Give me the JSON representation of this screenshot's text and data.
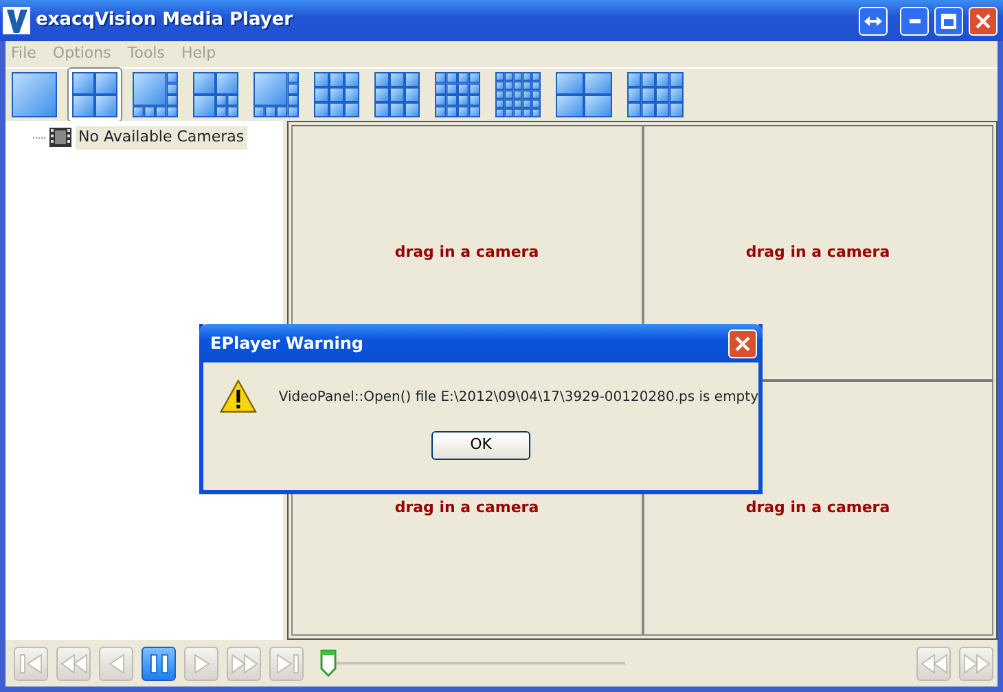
{
  "window": {
    "title": "exacqVision Media Player"
  },
  "menu": [
    "File",
    "Options",
    "Tools",
    "Help"
  ],
  "layouts": [
    {
      "selected": false
    },
    {
      "selected": true
    },
    {
      "selected": false
    },
    {
      "selected": false
    },
    {
      "selected": false
    },
    {
      "selected": false
    },
    {
      "selected": false
    },
    {
      "selected": false
    },
    {
      "selected": false
    },
    {
      "selected": false
    },
    {
      "selected": false
    }
  ],
  "tree": [
    {
      "label": "No Available Cameras",
      "selected": true
    }
  ],
  "video_cells": [
    "drag in a camera",
    "drag in a camera",
    "drag in a camera",
    "drag in a camera"
  ],
  "transport": [
    {
      "kind": "first",
      "selected": false
    },
    {
      "kind": "rewind",
      "selected": false
    },
    {
      "kind": "back",
      "selected": false
    },
    {
      "kind": "pause",
      "selected": true
    },
    {
      "kind": "play",
      "selected": false
    },
    {
      "kind": "forward",
      "selected": false
    },
    {
      "kind": "last",
      "selected": false
    }
  ],
  "timeline": {
    "level": 0
  },
  "transport_end": [
    {
      "kind": "rewind",
      "selected": false
    },
    {
      "kind": "forward",
      "selected": false
    }
  ],
  "dialog": {
    "title": "EPlayer Warning",
    "message": "VideoPanel::Open() file E:\\2012\\09\\04\\17\\3929-00120280.ps is empty",
    "buttons": [
      "OK"
    ]
  }
}
